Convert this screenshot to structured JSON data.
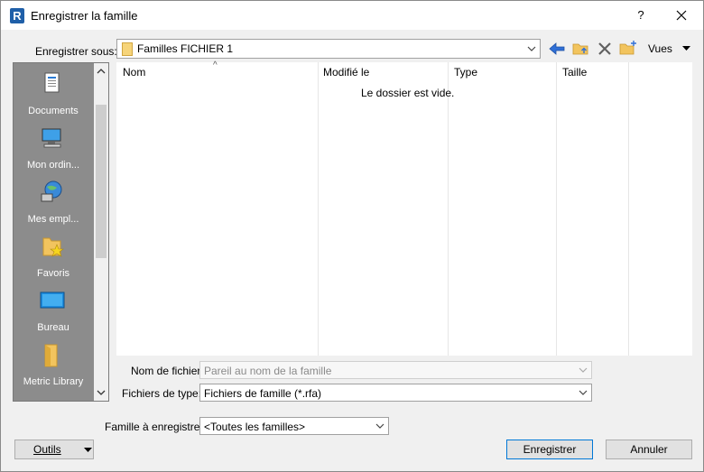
{
  "window": {
    "title": "Enregistrer la famille",
    "app_icon_letter": "R",
    "help_label": "?"
  },
  "save_in": {
    "label": "Enregistrer sous:",
    "value": "Familles FICHIER 1"
  },
  "toolbar": {
    "views_label": "Vues"
  },
  "places": [
    {
      "label": "Documents",
      "icon": "documents-icon"
    },
    {
      "label": "Mon ordin...",
      "icon": "computer-icon"
    },
    {
      "label": "Mes empl...",
      "icon": "network-places-icon"
    },
    {
      "label": "Favoris",
      "icon": "favorites-icon"
    },
    {
      "label": "Bureau",
      "icon": "desktop-icon"
    },
    {
      "label": "Metric Library",
      "icon": "folder-icon"
    }
  ],
  "file_list": {
    "columns": [
      "Nom",
      "Modifié le",
      "Type",
      "Taille"
    ],
    "sort_indicator": "^",
    "empty_message": "Le dossier est vide."
  },
  "filename": {
    "label": "Nom de fichier:",
    "value": "Pareil au nom de la famille"
  },
  "filetype": {
    "label": "Fichiers de type:",
    "value": "Fichiers de famille  (*.rfa)"
  },
  "family_to_save": {
    "label": "Famille à enregistrer:",
    "value": "<Toutes les familles>"
  },
  "buttons": {
    "tools": "Outils",
    "save": "Enregistrer",
    "cancel": "Annuler"
  }
}
